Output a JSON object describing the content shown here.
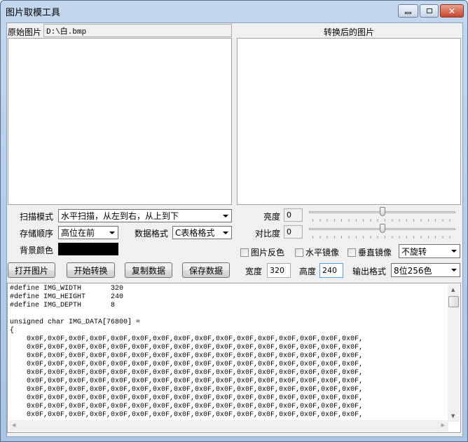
{
  "window": {
    "title": "图片取模工具"
  },
  "source": {
    "label": "原始图片",
    "path": "D:\\白.bmp"
  },
  "converted": {
    "label": "转换后的图片"
  },
  "controls": {
    "scan_mode_label": "扫描模式",
    "scan_mode_value": "水平扫描，从左到右，从上到下",
    "order_label": "存储顺序",
    "order_value": "高位在前",
    "data_format_label": "数据格式",
    "data_format_value": "C表格格式",
    "bg_color_label": "背景颜色",
    "bg_color": "#000000",
    "brightness_label": "亮度",
    "brightness_value": "0",
    "brightness_slider": 0.5,
    "contrast_label": "对比度",
    "contrast_value": "0",
    "contrast_slider": 0.5,
    "invert_label": "图片反色",
    "hmirror_label": "水平镜像",
    "vmirror_label": "垂直镜像",
    "rotate_value": "不旋转",
    "width_label": "宽度",
    "width_value": "320",
    "height_label": "高度",
    "height_value": "240",
    "output_label": "输出格式",
    "output_value": "8位256色"
  },
  "buttons": {
    "open": "打开图片",
    "convert": "开始转换",
    "copy": "复制数据",
    "save": "保存数据"
  },
  "code_lines": [
    "#define IMG_WIDTH       320",
    "#define IMG_HEIGHT      240",
    "#define IMG_DEPTH       8",
    "",
    "unsigned char IMG_DATA[76800] =",
    "{",
    "    0x0F,0x0F,0x0F,0x0F,0x0F,0x0F,0x0F,0x0F,0x0F,0x0F,0x0F,0x0F,0x0F,0x0F,0x0F,0x0F,",
    "    0x0F,0x0F,0x0F,0x0F,0x0F,0x0F,0x0F,0x0F,0x0F,0x0F,0x0F,0x0F,0x0F,0x0F,0x0F,0x0F,",
    "    0x0F,0x0F,0x0F,0x0F,0x0F,0x0F,0x0F,0x0F,0x0F,0x0F,0x0F,0x0F,0x0F,0x0F,0x0F,0x0F,",
    "    0x0F,0x0F,0x0F,0x0F,0x0F,0x0F,0x0F,0x0F,0x0F,0x0F,0x0F,0x0F,0x0F,0x0F,0x0F,0x0F,",
    "    0x0F,0x0F,0x0F,0x0F,0x0F,0x0F,0x0F,0x0F,0x0F,0x0F,0x0F,0x0F,0x0F,0x0F,0x0F,0x0F,",
    "    0x0F,0x0F,0x0F,0x0F,0x0F,0x0F,0x0F,0x0F,0x0F,0x0F,0x0F,0x0F,0x0F,0x0F,0x0F,0x0F,",
    "    0x0F,0x0F,0x0F,0x0F,0x0F,0x0F,0x0F,0x0F,0x0F,0x0F,0x0F,0x0F,0x0F,0x0F,0x0F,0x0F,",
    "    0x0F,0x0F,0x0F,0x0F,0x0F,0x0F,0x0F,0x0F,0x0F,0x0F,0x0F,0x0F,0x0F,0x0F,0x0F,0x0F,",
    "    0x0F,0x0F,0x0F,0x0F,0x0F,0x0F,0x0F,0x0F,0x0F,0x0F,0x0F,0x0F,0x0F,0x0F,0x0F,0x0F,",
    "    0x0F,0x0F,0x0F,0x0F,0x0F,0x0F,0x0F,0x0F,0x0F,0x0F,0x0F,0x0F,0x0F,0x0F,0x0F,0x0F,"
  ]
}
